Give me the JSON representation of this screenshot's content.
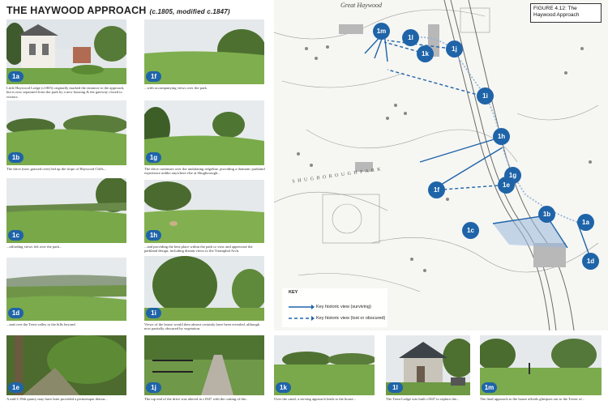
{
  "header": {
    "title": "THE HAYWOOD APPROACH",
    "subtitle": "(c.1805, modified c.1847)"
  },
  "figure": {
    "line1": "FIGURE 4.12: The",
    "line2": "Haywood Approach"
  },
  "map": {
    "place_label": "Great Haywood",
    "park_label": "S H U G B O R O U G H   P A R K"
  },
  "key": {
    "title": "KEY",
    "surviving": "Key historic view (surviving)",
    "lost": "Key historic view (lost or obscured)"
  },
  "photos": [
    {
      "id": "1a",
      "caption": "Little Haywood Lodge (c1805) originally marked the entrance to the approach, but is now separated from the park by a new housing & the gateway closed to visitors."
    },
    {
      "id": "1b",
      "caption": "The drive (now grassed over) led up the slope of Haywood Cliffs..."
    },
    {
      "id": "1c",
      "caption": "...affording views left over the park..."
    },
    {
      "id": "1d",
      "caption": "...and over the Trent valley to the hills beyond."
    },
    {
      "id": "1e",
      "caption": "A mid-C19th quarry may have later provided a picturesque detour..."
    },
    {
      "id": "1f",
      "caption": "...with accompanying views over the park."
    },
    {
      "id": "1g",
      "caption": "The drive continues over the undulating ridgeline, providing a dramatic parkland experience unlike anywhere else at Shugborough..."
    },
    {
      "id": "1h",
      "caption": "...and providing the best place within the park to view and appreciate the parkland design, including distant views to the Triumphal Arch."
    },
    {
      "id": "1i",
      "caption": "Views of the house would then almost certainly have been revealed, although now partially obscured by vegetation."
    },
    {
      "id": "1j",
      "caption": "The top end of the drive was altered in c1847 with the cutting of the..."
    },
    {
      "id": "1k",
      "caption": "Over the canal, a serving approach leads to the house..."
    },
    {
      "id": "1l",
      "caption": "The Trent Lodge was built c1847 to replace the..."
    },
    {
      "id": "1m",
      "caption": "The final approach to the house affords glimpses out to the Tower of..."
    }
  ],
  "map_markers": [
    "1a",
    "1b",
    "1c",
    "1d",
    "1e",
    "1f",
    "1g",
    "1h",
    "1i",
    "1j",
    "1k",
    "1l",
    "1m"
  ],
  "colors": {
    "accent": "#1f64a8",
    "line_light": "#8fb3d9",
    "sky": "#e9ecee",
    "grass": "#7fa34f"
  }
}
